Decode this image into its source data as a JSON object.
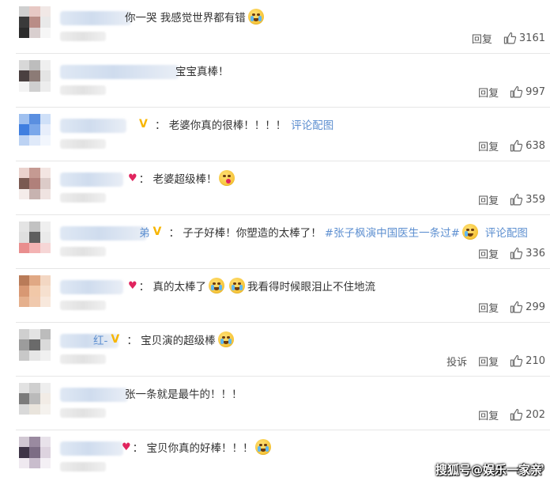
{
  "reply_label": "回复",
  "report_label": "投诉",
  "icons": {
    "like": "thumbs-up-icon",
    "verified": "verified-v-icon",
    "heart": "heart-icon"
  },
  "colors": {
    "link": "#5d8fd0",
    "verified": "#f7b500",
    "text": "#333333"
  },
  "watermark": "搜狐号@娱乐一家亲",
  "comments": [
    {
      "segments": [
        {
          "t": "你一哭 我感觉世界都有错"
        },
        {
          "e": "cry"
        }
      ],
      "likes": "3161",
      "show_report": false
    },
    {
      "segments": [
        {
          "t": "宝宝真棒！"
        }
      ],
      "likes": "997",
      "show_report": false
    },
    {
      "name_fragment": "",
      "verified": true,
      "segments": [
        {
          "t": "：  老婆你真的很棒！！！！"
        },
        {
          "l": "评论配图"
        }
      ],
      "likes": "638",
      "show_report": false
    },
    {
      "heart": true,
      "segments": [
        {
          "t": "：  老婆超级棒！"
        },
        {
          "e": "love"
        }
      ],
      "likes": "359",
      "show_report": false
    },
    {
      "name_fragment": "弟",
      "verified": true,
      "segments": [
        {
          "t": "：  子子好棒！你塑造的太棒了！"
        },
        {
          "h": "#张子枫演中国医生一条过#"
        },
        {
          "e": "sad"
        },
        {
          "l": "评论配图"
        }
      ],
      "likes": "336",
      "show_report": false
    },
    {
      "heart": true,
      "segments": [
        {
          "t": "：  真的太棒了"
        },
        {
          "e": "cry"
        },
        {
          "e": "cry"
        },
        {
          "t": "我看得时候眼泪止不住地流"
        }
      ],
      "likes": "299",
      "show_report": false
    },
    {
      "name_fragment": "红-",
      "verified": true,
      "segments": [
        {
          "t": "：  宝贝演的超级棒"
        },
        {
          "e": "cry"
        }
      ],
      "likes": "210",
      "show_report": true
    },
    {
      "segments": [
        {
          "t": "张一条就是最牛的！！！"
        }
      ],
      "likes": "202",
      "show_report": false
    },
    {
      "heart": true,
      "segments": [
        {
          "t": "：  宝贝你真的好棒！！！"
        },
        {
          "e": "cry"
        }
      ],
      "likes": "39",
      "show_report": false
    }
  ]
}
